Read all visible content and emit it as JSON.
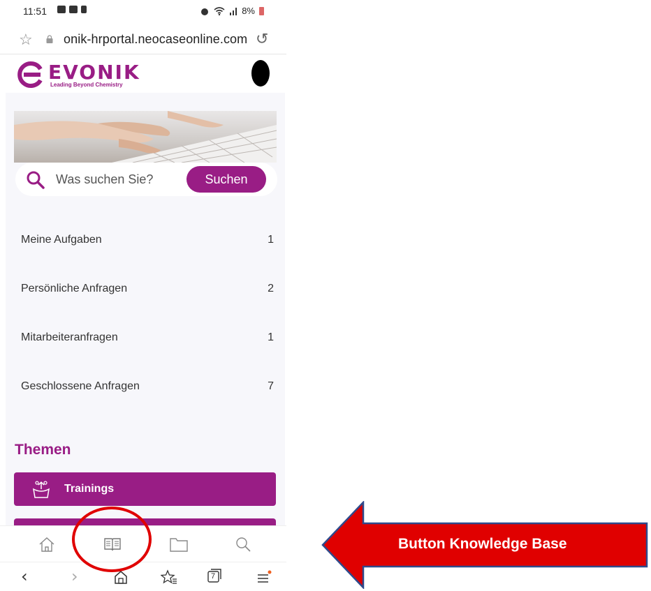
{
  "status_bar": {
    "time": "11:51",
    "battery": "8%"
  },
  "browser": {
    "url": "onik-hrportal.neocaseonline.com"
  },
  "brand": {
    "name": "EVONIK",
    "tagline": "Leading Beyond Chemistry",
    "color": "#991d85"
  },
  "search": {
    "placeholder": "Was suchen Sie?",
    "button": "Suchen"
  },
  "requests": [
    {
      "label": "Meine Aufgaben",
      "count": "1"
    },
    {
      "label": "Persönliche Anfragen",
      "count": "2"
    },
    {
      "label": "Mitarbeiteranfragen",
      "count": "1"
    },
    {
      "label": "Geschlossene Anfragen",
      "count": "7"
    }
  ],
  "topics": {
    "heading": "Themen",
    "items": [
      {
        "label": "Trainings",
        "icon": "training-icon"
      }
    ]
  },
  "toolbar": {
    "icons": [
      "home-icon",
      "knowledge-base-icon",
      "folder-icon",
      "search-icon"
    ]
  },
  "navbar": {
    "icons": [
      "back-icon",
      "forward-icon",
      "home-icon",
      "bookmarks-icon",
      "tabs-icon",
      "menu-icon"
    ],
    "tab_count": "7"
  },
  "annotation": {
    "label": "Button Knowledge Base",
    "color": "#e00000",
    "arrow_color": "#e00000",
    "arrow_outline": "#2f4a8c"
  }
}
